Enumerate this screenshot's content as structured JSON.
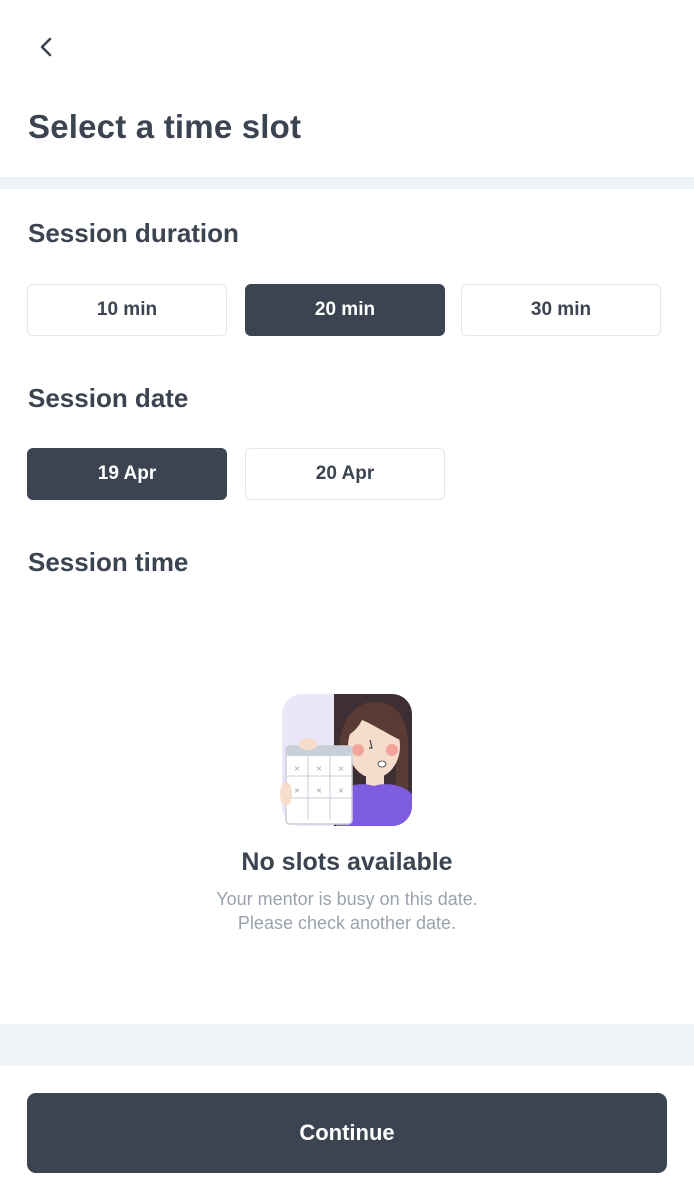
{
  "header": {
    "back_icon": "chevron-left-icon",
    "title": "Select a time slot"
  },
  "duration": {
    "label": "Session duration",
    "options": [
      "10 min",
      "20 min",
      "30 min"
    ],
    "selected": "20 min"
  },
  "date": {
    "label": "Session date",
    "options": [
      "19 Apr",
      "20 Apr"
    ],
    "selected": "19 Apr"
  },
  "time": {
    "label": "Session time",
    "empty_state": {
      "illustration": "person-holding-calendar-illustration",
      "title": "No slots available",
      "line1": "Your mentor is busy on this date.",
      "line2": "Please check another date."
    }
  },
  "footer": {
    "continue_label": "Continue"
  },
  "colors": {
    "primary": "#3b4450",
    "muted_text": "#9aa2ad",
    "band": "#eef3f8",
    "chip_border": "#e3e7ec",
    "illustration_purple": "#7d5ce0"
  }
}
